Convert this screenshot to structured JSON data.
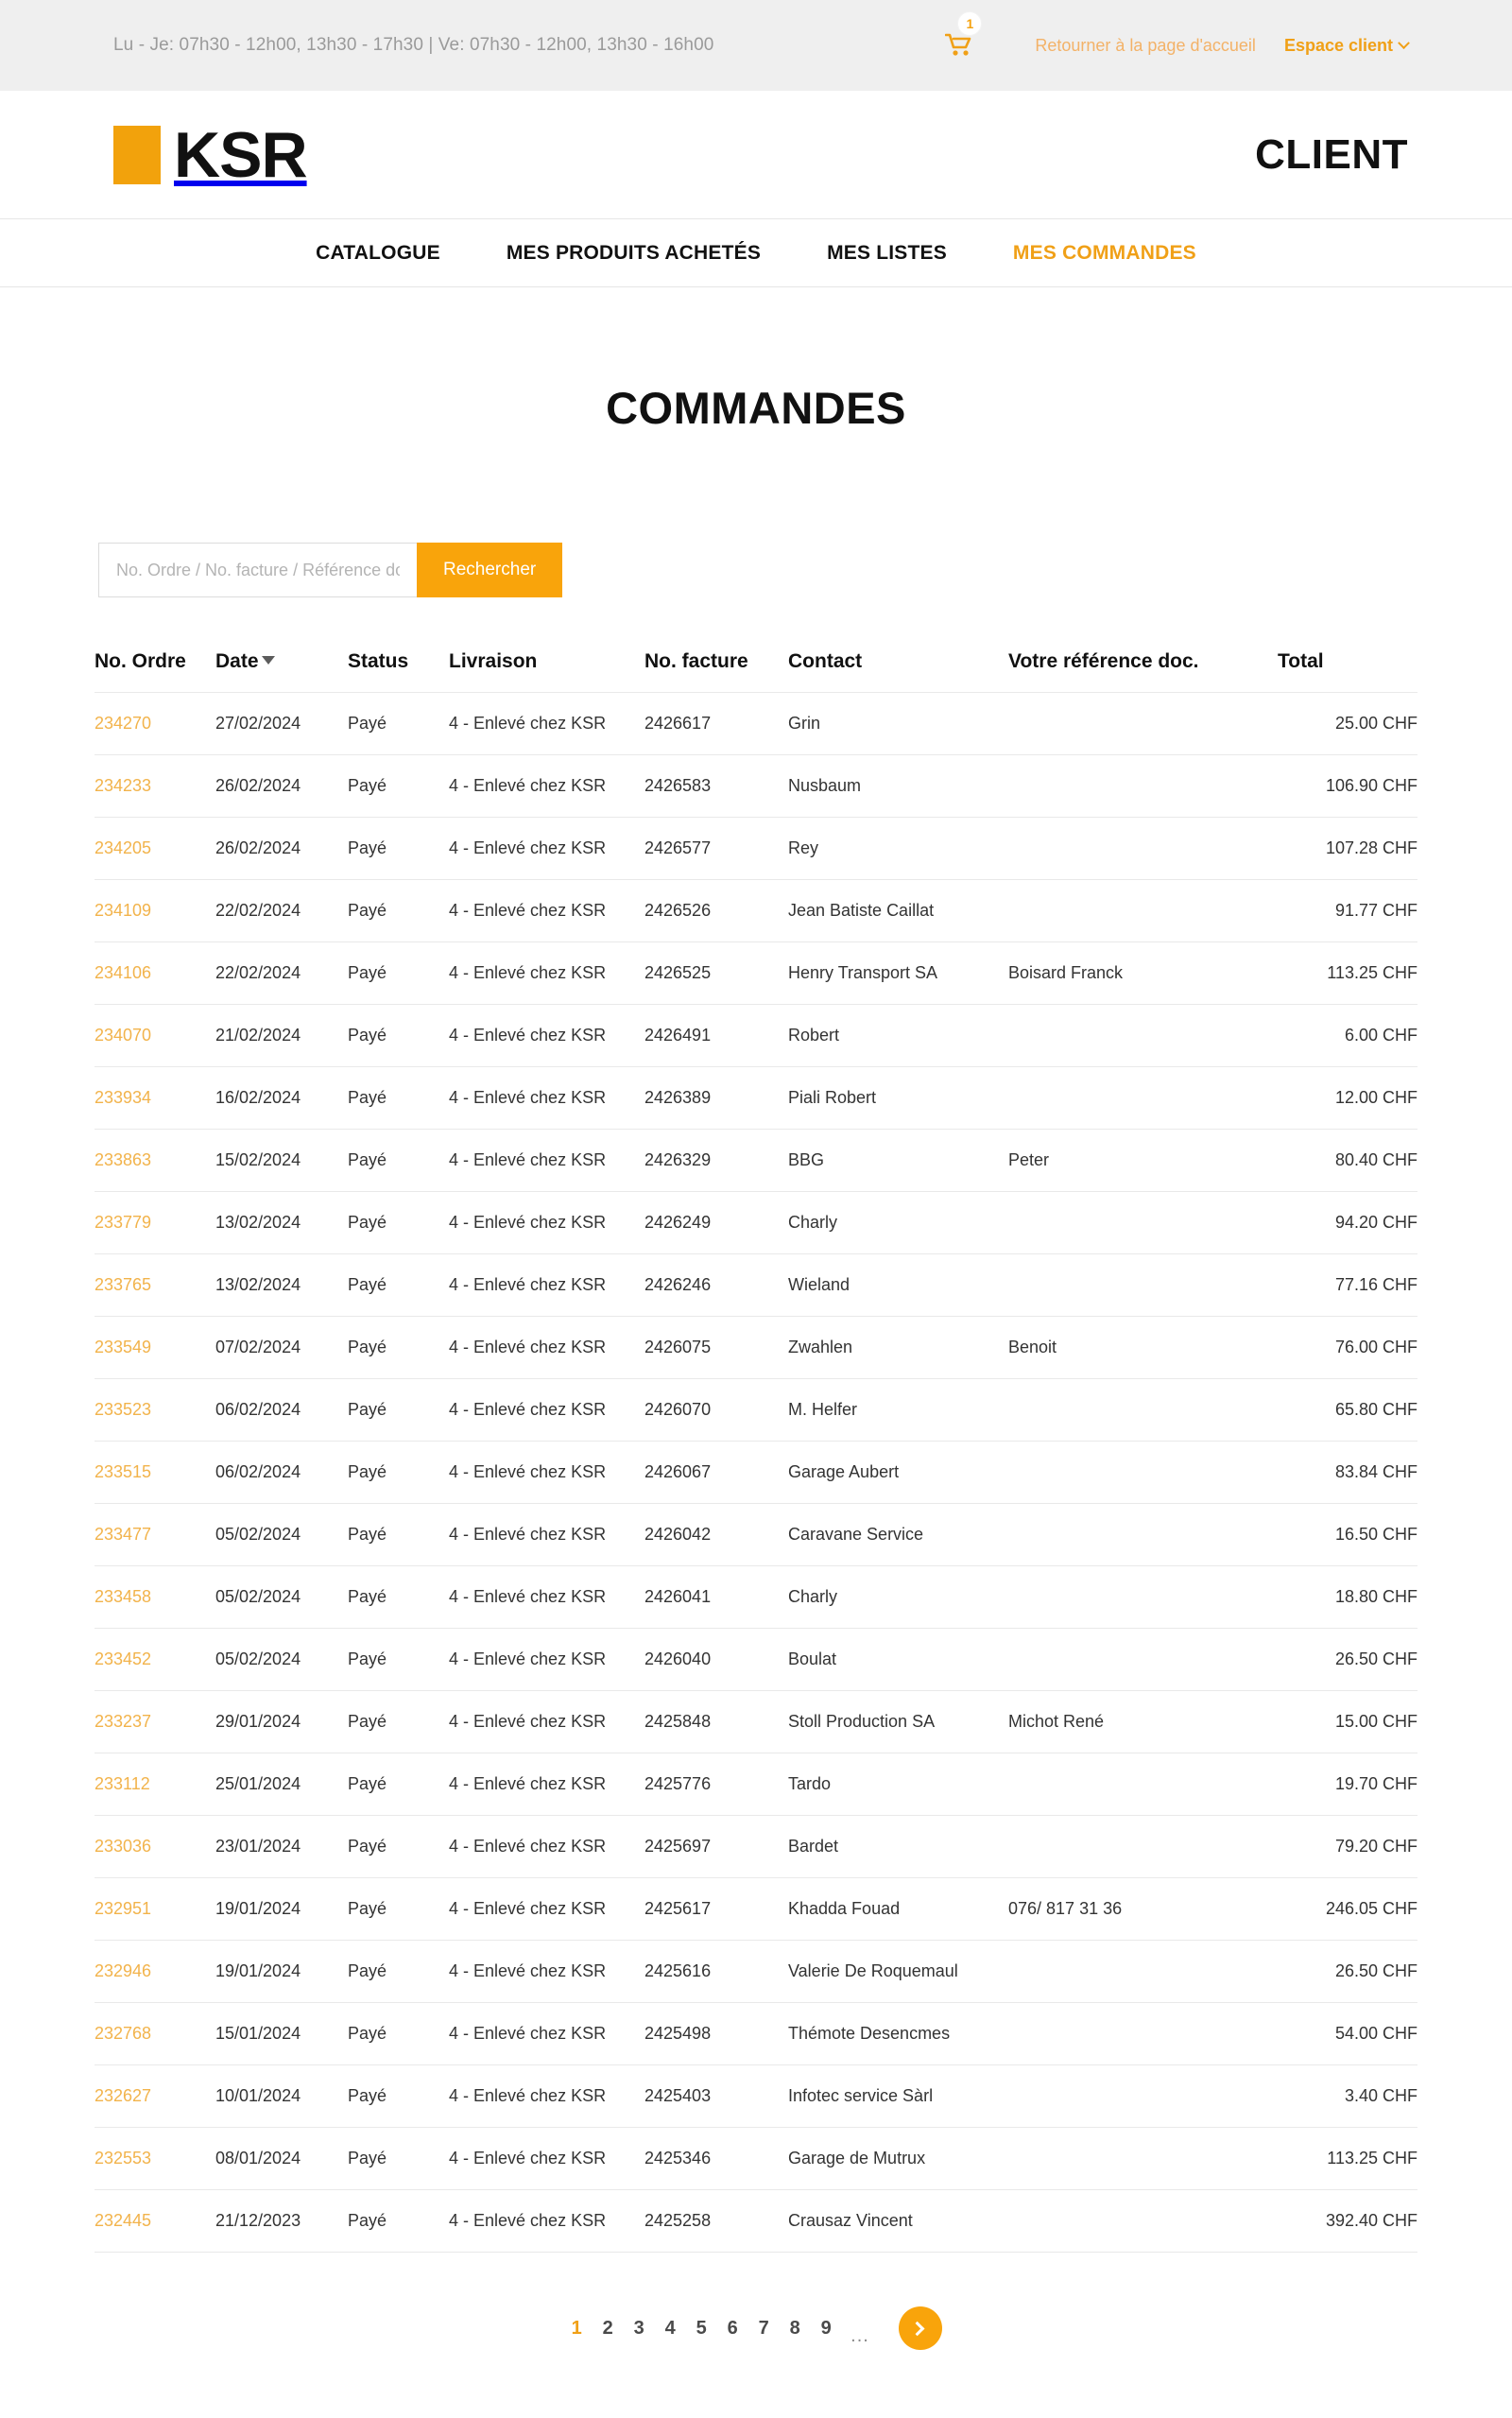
{
  "utility_bar": {
    "opening_hours": "Lu - Je: 07h30 - 12h00, 13h30 - 17h30 | Ve: 07h30 - 12h00, 13h30 - 16h00",
    "cart_icon": "shopping-cart-icon",
    "cart_count": "1",
    "home_link": "Retourner à la page d'accueil",
    "account_link": "Espace client"
  },
  "brand": {
    "logo_text": "KSR",
    "logo_accent_color": "#f2a20c",
    "client_label": "CLIENT"
  },
  "nav": {
    "items": [
      {
        "label": "CATALOGUE",
        "active": false
      },
      {
        "label": "MES PRODUITS ACHETÉS",
        "active": false
      },
      {
        "label": "MES LISTES",
        "active": false
      },
      {
        "label": "MES COMMANDES",
        "active": true
      }
    ]
  },
  "page": {
    "title": "COMMANDES"
  },
  "search": {
    "placeholder": "No. Ordre / No. facture / Référence doc.",
    "value": "",
    "button_label": "Rechercher"
  },
  "table": {
    "columns": [
      {
        "label": "No. Ordre",
        "sortable": true
      },
      {
        "label": "Date",
        "sortable": true,
        "sorted": "desc"
      },
      {
        "label": "Status",
        "sortable": true
      },
      {
        "label": "Livraison",
        "sortable": false
      },
      {
        "label": "No. facture",
        "sortable": false
      },
      {
        "label": "Contact",
        "sortable": false
      },
      {
        "label": "Votre référence doc.",
        "sortable": false
      },
      {
        "label": "Total",
        "sortable": false
      }
    ],
    "rows": [
      {
        "order": "234270",
        "date": "27/02/2024",
        "status": "Payé",
        "livraison": "4 - Enlevé chez KSR",
        "facture": "2426617",
        "contact": "Grin",
        "reference": "",
        "total": "25.00 CHF"
      },
      {
        "order": "234233",
        "date": "26/02/2024",
        "status": "Payé",
        "livraison": "4 - Enlevé chez KSR",
        "facture": "2426583",
        "contact": "Nusbaum",
        "reference": "",
        "total": "106.90 CHF"
      },
      {
        "order": "234205",
        "date": "26/02/2024",
        "status": "Payé",
        "livraison": "4 - Enlevé chez KSR",
        "facture": "2426577",
        "contact": "Rey",
        "reference": "",
        "total": "107.28 CHF"
      },
      {
        "order": "234109",
        "date": "22/02/2024",
        "status": "Payé",
        "livraison": "4 - Enlevé chez KSR",
        "facture": "2426526",
        "contact": "Jean Batiste Caillat",
        "reference": "",
        "total": "91.77 CHF"
      },
      {
        "order": "234106",
        "date": "22/02/2024",
        "status": "Payé",
        "livraison": "4 - Enlevé chez KSR",
        "facture": "2426525",
        "contact": "Henry Transport SA",
        "reference": "Boisard Franck",
        "total": "113.25 CHF"
      },
      {
        "order": "234070",
        "date": "21/02/2024",
        "status": "Payé",
        "livraison": "4 - Enlevé chez KSR",
        "facture": "2426491",
        "contact": "Robert",
        "reference": "",
        "total": "6.00 CHF"
      },
      {
        "order": "233934",
        "date": "16/02/2024",
        "status": "Payé",
        "livraison": "4 - Enlevé chez KSR",
        "facture": "2426389",
        "contact": "Piali Robert",
        "reference": "",
        "total": "12.00 CHF"
      },
      {
        "order": "233863",
        "date": "15/02/2024",
        "status": "Payé",
        "livraison": "4 - Enlevé chez KSR",
        "facture": "2426329",
        "contact": "BBG",
        "reference": "Peter",
        "total": "80.40 CHF"
      },
      {
        "order": "233779",
        "date": "13/02/2024",
        "status": "Payé",
        "livraison": "4 - Enlevé chez KSR",
        "facture": "2426249",
        "contact": "Charly",
        "reference": "",
        "total": "94.20 CHF"
      },
      {
        "order": "233765",
        "date": "13/02/2024",
        "status": "Payé",
        "livraison": "4 - Enlevé chez KSR",
        "facture": "2426246",
        "contact": "Wieland",
        "reference": "",
        "total": "77.16 CHF"
      },
      {
        "order": "233549",
        "date": "07/02/2024",
        "status": "Payé",
        "livraison": "4 - Enlevé chez KSR",
        "facture": "2426075",
        "contact": "Zwahlen",
        "reference": "Benoit",
        "total": "76.00 CHF"
      },
      {
        "order": "233523",
        "date": "06/02/2024",
        "status": "Payé",
        "livraison": "4 - Enlevé chez KSR",
        "facture": "2426070",
        "contact": "M. Helfer",
        "reference": "",
        "total": "65.80 CHF"
      },
      {
        "order": "233515",
        "date": "06/02/2024",
        "status": "Payé",
        "livraison": "4 - Enlevé chez KSR",
        "facture": "2426067",
        "contact": "Garage Aubert",
        "reference": "",
        "total": "83.84 CHF"
      },
      {
        "order": "233477",
        "date": "05/02/2024",
        "status": "Payé",
        "livraison": "4 - Enlevé chez KSR",
        "facture": "2426042",
        "contact": "Caravane Service",
        "reference": "",
        "total": "16.50 CHF"
      },
      {
        "order": "233458",
        "date": "05/02/2024",
        "status": "Payé",
        "livraison": "4 - Enlevé chez KSR",
        "facture": "2426041",
        "contact": "Charly",
        "reference": "",
        "total": "18.80 CHF"
      },
      {
        "order": "233452",
        "date": "05/02/2024",
        "status": "Payé",
        "livraison": "4 - Enlevé chez KSR",
        "facture": "2426040",
        "contact": "Boulat",
        "reference": "",
        "total": "26.50 CHF"
      },
      {
        "order": "233237",
        "date": "29/01/2024",
        "status": "Payé",
        "livraison": "4 - Enlevé chez KSR",
        "facture": "2425848",
        "contact": "Stoll Production SA",
        "reference": "Michot René",
        "total": "15.00 CHF"
      },
      {
        "order": "233112",
        "date": "25/01/2024",
        "status": "Payé",
        "livraison": "4 - Enlevé chez KSR",
        "facture": "2425776",
        "contact": "Tardo",
        "reference": "",
        "total": "19.70 CHF"
      },
      {
        "order": "233036",
        "date": "23/01/2024",
        "status": "Payé",
        "livraison": "4 - Enlevé chez KSR",
        "facture": "2425697",
        "contact": "Bardet",
        "reference": "",
        "total": "79.20 CHF"
      },
      {
        "order": "232951",
        "date": "19/01/2024",
        "status": "Payé",
        "livraison": "4 - Enlevé chez KSR",
        "facture": "2425617",
        "contact": "Khadda Fouad",
        "reference": "076/ 817 31 36",
        "total": "246.05 CHF"
      },
      {
        "order": "232946",
        "date": "19/01/2024",
        "status": "Payé",
        "livraison": "4 - Enlevé chez KSR",
        "facture": "2425616",
        "contact": "Valerie De Roquemaul",
        "reference": "",
        "total": "26.50 CHF"
      },
      {
        "order": "232768",
        "date": "15/01/2024",
        "status": "Payé",
        "livraison": "4 - Enlevé chez KSR",
        "facture": "2425498",
        "contact": "Thémote Desencmes",
        "reference": "",
        "total": "54.00 CHF"
      },
      {
        "order": "232627",
        "date": "10/01/2024",
        "status": "Payé",
        "livraison": "4 - Enlevé chez KSR",
        "facture": "2425403",
        "contact": "Infotec service Sàrl",
        "reference": "",
        "total": "3.40 CHF"
      },
      {
        "order": "232553",
        "date": "08/01/2024",
        "status": "Payé",
        "livraison": "4 - Enlevé chez KSR",
        "facture": "2425346",
        "contact": "Garage de Mutrux",
        "reference": "",
        "total": "113.25 CHF"
      },
      {
        "order": "232445",
        "date": "21/12/2023",
        "status": "Payé",
        "livraison": "4 - Enlevé chez KSR",
        "facture": "2425258",
        "contact": "Crausaz Vincent",
        "reference": "",
        "total": "392.40 CHF"
      }
    ]
  },
  "pagination": {
    "pages": [
      "1",
      "2",
      "3",
      "4",
      "5",
      "6",
      "7",
      "8",
      "9"
    ],
    "current": "1",
    "ellipsis": "...",
    "next_icon": "chevron-right-icon"
  },
  "colors": {
    "accent": "#f0a017",
    "button": "#f9a40b",
    "utility_bg": "#efefef"
  }
}
